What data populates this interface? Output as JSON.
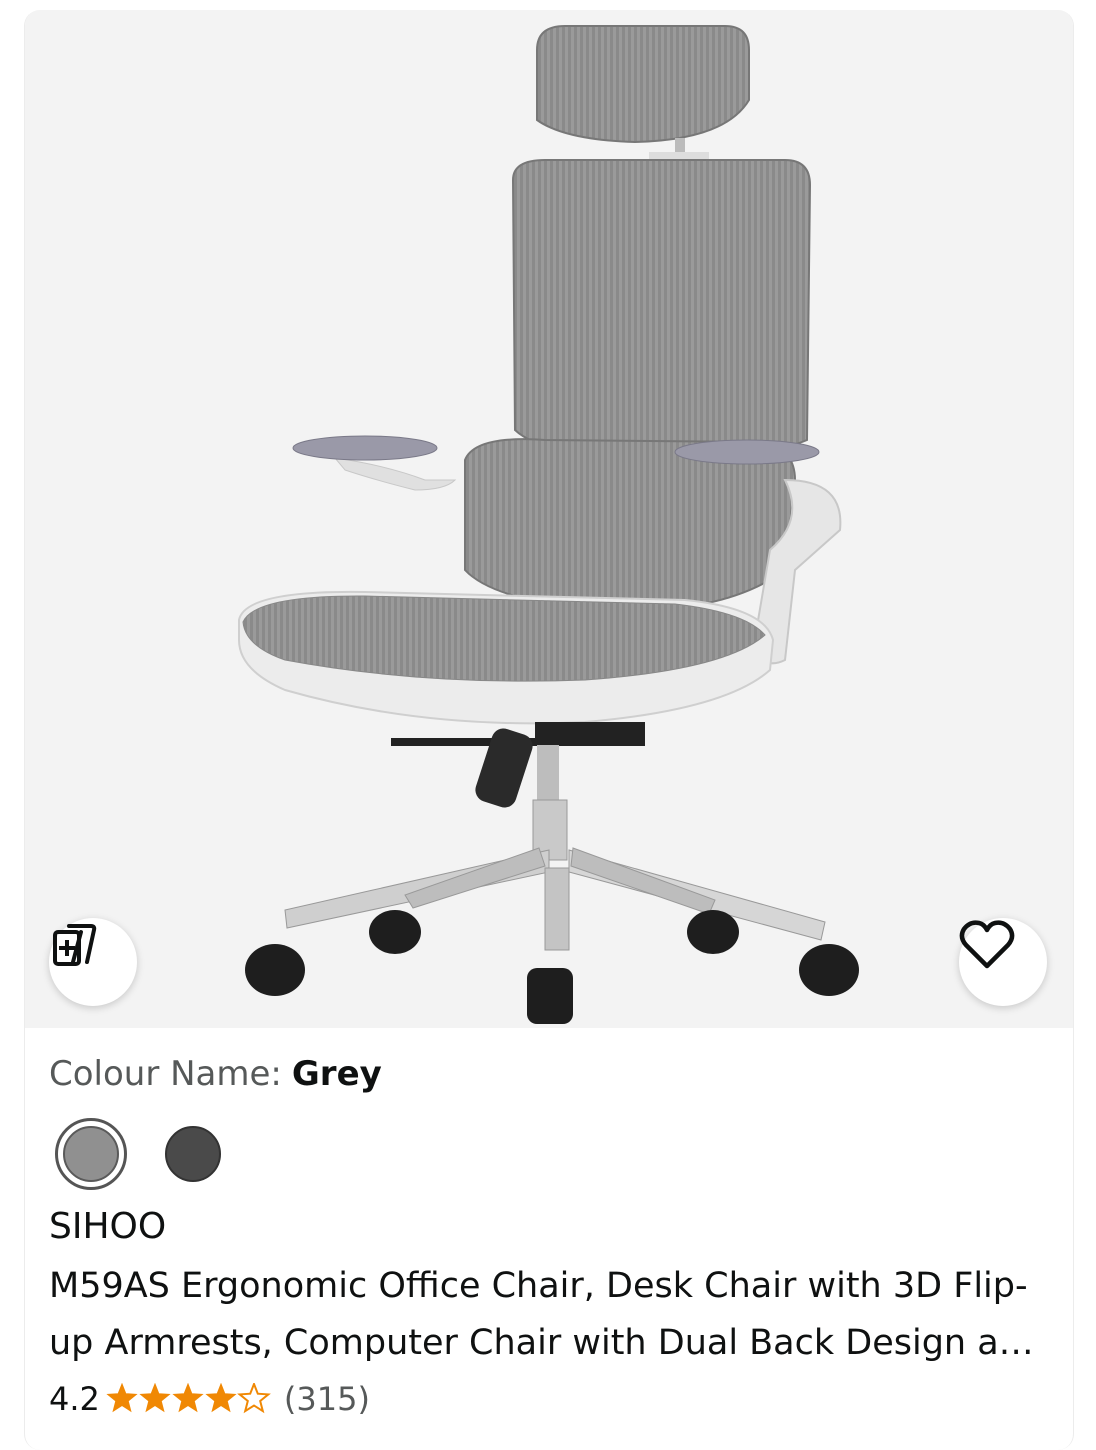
{
  "product": {
    "colour_label": "Colour Name:",
    "colour_value": "Grey",
    "swatches": [
      {
        "name": "Grey",
        "color": "#909090",
        "selected": true
      },
      {
        "name": "Dark",
        "color": "#4a4a4a",
        "selected": false
      }
    ],
    "brand": "SIHOO",
    "title": "M59AS Ergonomic Office Chair, Desk Chair with 3D Flip-up Armrests, Computer Chair with Dual Back Design a…",
    "rating": "4.2",
    "rating_value": 4.2,
    "rating_max": 5,
    "review_count": "(315)"
  },
  "icons": {
    "compare": "compare-icon",
    "wishlist": "heart-icon",
    "star_color": "#f08804"
  },
  "image": {
    "alt": "Grey mesh ergonomic office chair"
  }
}
